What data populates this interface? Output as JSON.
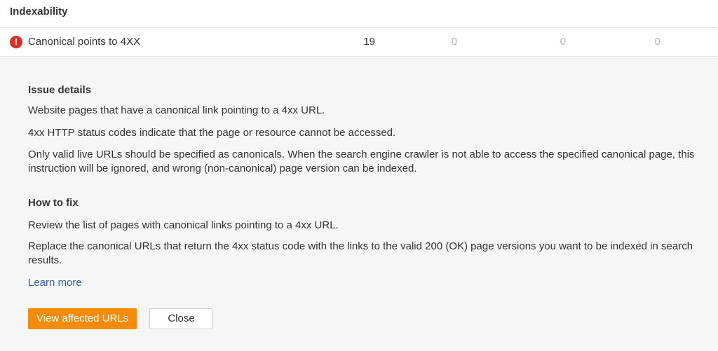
{
  "section": {
    "title": "Indexability"
  },
  "issue": {
    "icon": "error-icon",
    "icon_glyph": "!",
    "name": "Canonical points to 4XX",
    "counts": [
      "19",
      "0",
      "0",
      "0"
    ]
  },
  "details": {
    "issue_heading": "Issue details",
    "issue_paragraphs": [
      "Website pages that have a canonical link pointing to a 4xx URL.",
      "4xx HTTP status codes indicate that the page or resource cannot be accessed.",
      "Only valid live URLs should be specified as canonicals. When the search engine crawler is not able to access the specified canonical page, this instruction will be ignored, and wrong (non-canonical) page version can be indexed."
    ],
    "fix_heading": "How to fix",
    "fix_paragraphs": [
      "Review the list of pages with canonical links pointing to a 4xx URL.",
      "Replace the canonical URLs that return the 4xx status code with the links to the valid 200 (OK) page versions you want to be indexed in search results."
    ],
    "learn_more": "Learn more"
  },
  "actions": {
    "primary_label": "View affected URLs",
    "secondary_label": "Close"
  },
  "colors": {
    "accent": "#f58b0b",
    "error": "#d93025",
    "link": "#2f5fa8",
    "panel_bg": "#f6f6f7"
  }
}
